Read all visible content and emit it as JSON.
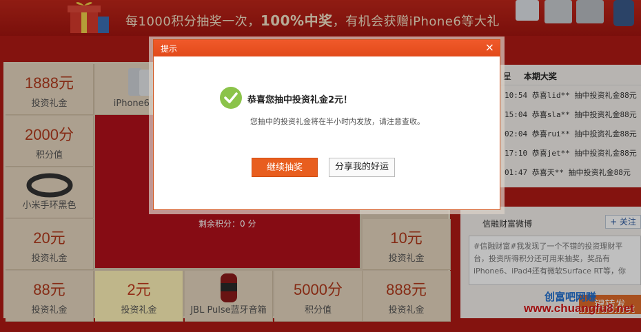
{
  "banner": {
    "text_prefix": "每1000积分抽奖一次，",
    "text_bold": "100%中奖",
    "text_suffix": "，有机会获赠iPhone6等大礼"
  },
  "grid": {
    "cells": [
      {
        "value": "1888元",
        "label": "投资礼金"
      },
      {
        "value": "",
        "label": "iPhone6（4"
      },
      {
        "value": "2000分",
        "label": "积分值"
      },
      {
        "value": "",
        "label": "小米手环黑色"
      },
      {
        "value": "20元",
        "label": "投资礼金"
      },
      {
        "value": "88元",
        "label": "投资礼金"
      },
      {
        "value": "2元",
        "label": "投资礼金"
      },
      {
        "value": "",
        "label": "JBL Pulse蓝牙音箱"
      },
      {
        "value": "5000分",
        "label": "积分值"
      },
      {
        "value": "888元",
        "label": "投资礼金"
      },
      {
        "value": "10元",
        "label": "投资礼金"
      }
    ],
    "remaining_label": "剩余积分：0 分"
  },
  "winners": {
    "header_left": "星",
    "header_right": "本期大奖",
    "rows": [
      "10:54 恭喜lid** 抽中投资礼金88元",
      "15:04 恭喜sla** 抽中投资礼金88元",
      "02:04 恭喜rui** 抽中投资礼金88元",
      "17:10 恭喜jet** 抽中投资礼金88元",
      "01:47 恭喜天** 抽中投资礼金88元"
    ]
  },
  "weibo": {
    "title": "信融财富微博",
    "follow": "+ 关注",
    "content": "#信融财富#我发现了一个不错的投资理财平台，投资所得积分还可用来抽奖，奖品有iPhone6、iPad4还有微软Surface RT等，你",
    "share_button": "键转发"
  },
  "watermark": {
    "cn": "创富吧网赚",
    "url": "www.chuangfu8.net"
  },
  "dialog": {
    "title": "提示",
    "close": "×",
    "message_title": "恭喜您抽中投资礼金2元！",
    "message_sub": "您抽中的投资礼金将在半小时内发放，请注意查收。",
    "continue_button": "继续抽奖",
    "share_button": "分享我的好运"
  },
  "colors": {
    "accent": "#e85e1f",
    "page_red": "#b01a14",
    "success_green": "#8bc34a"
  }
}
